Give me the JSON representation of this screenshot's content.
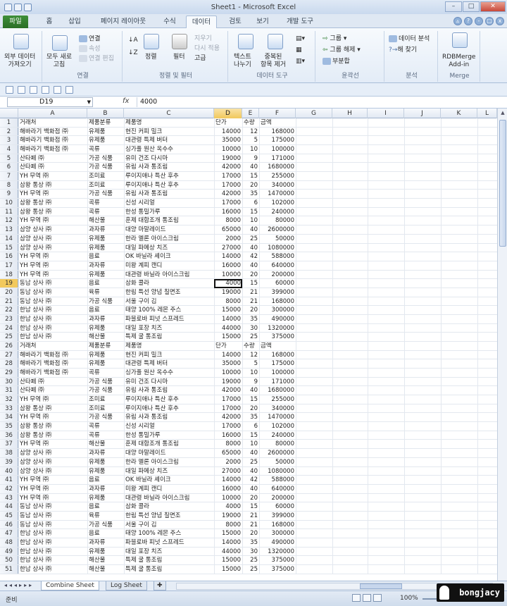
{
  "window": {
    "title": "Sheet1 - Microsoft Excel"
  },
  "tabs": [
    "파일",
    "홈",
    "삽입",
    "페이지 레이아웃",
    "수식",
    "데이터",
    "검토",
    "보기",
    "개발 도구"
  ],
  "active_tab": "데이터",
  "ribbon": {
    "groups": {
      "external": {
        "button": "외부 데이터\n가져오기",
        "label": ""
      },
      "connections": {
        "refresh": "모두 새로\n고침",
        "conn": "연결",
        "props": "속성",
        "edit_links": "연결 편집",
        "label": "연결"
      },
      "sort": {
        "sort": "정렬",
        "filter": "필터",
        "clear": "지우기",
        "reapply": "다시 적용",
        "advanced": "고급",
        "label": "정렬 및 필터"
      },
      "tools": {
        "text": "텍스트\n나누기",
        "dup": "중복된\n항목 제거",
        "label": "데이터 도구"
      },
      "outline": {
        "group": "그룹",
        "ungroup": "그룹 해제",
        "subtotal": "부분합",
        "label": "윤곽선"
      },
      "analysis": {
        "analyze": "데이터 분석",
        "solver": "해 찾기",
        "label": "분석"
      },
      "merge": {
        "btn": "RDBMerge\nAdd-in",
        "label": "Merge"
      }
    }
  },
  "formula_bar": {
    "name_box": "D19",
    "fx": "fx",
    "value": "4000"
  },
  "columns": [
    "A",
    "B",
    "C",
    "D",
    "E",
    "F",
    "G",
    "H",
    "I",
    "J",
    "K",
    "L"
  ],
  "selected_column": "D",
  "selected_row": 19,
  "rows": [
    [
      "거래처",
      "제품분류",
      "제품명",
      "단가",
      "수량",
      "금액"
    ],
    [
      "해바라기 백화점 ㈜",
      "유제품",
      "현진 커피 밀크",
      "14000",
      "12",
      "168000"
    ],
    [
      "해바라기 백화점 ㈜",
      "유제품",
      "대관령 특제 버터",
      "35000",
      "5",
      "175000"
    ],
    [
      "해바라기 백화점 ㈜",
      "곡류",
      "싱가풀 원산 옥수수",
      "10000",
      "10",
      "100000"
    ],
    [
      "산타페 ㈜",
      "가공 식품",
      "유미 건조 다시마",
      "19000",
      "9",
      "171000"
    ],
    [
      "산타페 ㈜",
      "가공 식품",
      "유림 사과 통조림",
      "42000",
      "40",
      "1680000"
    ],
    [
      "YH 무역 ㈜",
      "조미료",
      "루이지애나 특산 후추",
      "17000",
      "15",
      "255000"
    ],
    [
      "삼왕 통상 ㈜",
      "조미료",
      "루이지애나 특산 후추",
      "17000",
      "20",
      "340000"
    ],
    [
      "YH 무역 ㈜",
      "가공 식품",
      "유림 사과 통조림",
      "42000",
      "35",
      "1470000"
    ],
    [
      "삼왕 통상 ㈜",
      "곡류",
      "신성 시리얼",
      "17000",
      "6",
      "102000"
    ],
    [
      "삼왕 통상 ㈜",
      "곡류",
      "한성 통밀가루",
      "16000",
      "15",
      "240000"
    ],
    [
      "YH 무역 ㈜",
      "해산물",
      "훈제 대합조개 통조림",
      "8000",
      "10",
      "80000"
    ],
    [
      "삼양 상사 ㈜",
      "과자류",
      "대양 마말레이드",
      "65000",
      "40",
      "2600000"
    ],
    [
      "삼양 상사 ㈜",
      "유제품",
      "한라 멜론 아이스크림",
      "2000",
      "25",
      "50000"
    ],
    [
      "삼양 상사 ㈜",
      "유제품",
      "대일 파메상 치즈",
      "27000",
      "40",
      "1080000"
    ],
    [
      "YH 무역 ㈜",
      "음료",
      "OK 바닐라 셰이크",
      "14000",
      "42",
      "588000"
    ],
    [
      "YH 무역 ㈜",
      "과자류",
      "미왕 계피 캔디",
      "16000",
      "40",
      "640000"
    ],
    [
      "YH 무역 ㈜",
      "유제품",
      "대관령 바닐라 아이스크림",
      "10000",
      "20",
      "200000"
    ],
    [
      "동남 상사 ㈜",
      "음료",
      "삼화 콜라",
      "4000",
      "15",
      "60000"
    ],
    [
      "동남 상사 ㈜",
      "육류",
      "한림 특선 양념 칠면조",
      "19000",
      "21",
      "399000"
    ],
    [
      "동남 상사 ㈜",
      "가공 식품",
      "서울 구이 김",
      "8000",
      "21",
      "168000"
    ],
    [
      "한남 상사 ㈜",
      "음료",
      "태양 100% 레몬 주스",
      "15000",
      "20",
      "300000"
    ],
    [
      "한남 상사 ㈜",
      "과자류",
      "파블로바 피넛 스프레드",
      "14000",
      "35",
      "490000"
    ],
    [
      "한남 상사 ㈜",
      "유제품",
      "대일 포장 치즈",
      "44000",
      "30",
      "1320000"
    ],
    [
      "한남 상사 ㈜",
      "해산물",
      "특제 굴 통조림",
      "15000",
      "25",
      "375000"
    ],
    [
      "거래처",
      "제품분류",
      "제품명",
      "단가",
      "수량",
      "금액"
    ],
    [
      "해바라기 백화점 ㈜",
      "유제품",
      "현진 커피 밀크",
      "14000",
      "12",
      "168000"
    ],
    [
      "해바라기 백화점 ㈜",
      "유제품",
      "대관령 특제 버터",
      "35000",
      "5",
      "175000"
    ],
    [
      "해바라기 백화점 ㈜",
      "곡류",
      "싱가풀 원산 옥수수",
      "10000",
      "10",
      "100000"
    ],
    [
      "산타페 ㈜",
      "가공 식품",
      "유미 건조 다시마",
      "19000",
      "9",
      "171000"
    ],
    [
      "산타페 ㈜",
      "가공 식품",
      "유림 사과 통조림",
      "42000",
      "40",
      "1680000"
    ],
    [
      "YH 무역 ㈜",
      "조미료",
      "루이지애나 특산 후추",
      "17000",
      "15",
      "255000"
    ],
    [
      "삼왕 통상 ㈜",
      "조미료",
      "루이지애나 특산 후추",
      "17000",
      "20",
      "340000"
    ],
    [
      "YH 무역 ㈜",
      "가공 식품",
      "유림 사과 통조림",
      "42000",
      "35",
      "1470000"
    ],
    [
      "삼왕 통상 ㈜",
      "곡류",
      "신성 시리얼",
      "17000",
      "6",
      "102000"
    ],
    [
      "삼왕 통상 ㈜",
      "곡류",
      "한성 통밀가루",
      "16000",
      "15",
      "240000"
    ],
    [
      "YH 무역 ㈜",
      "해산물",
      "훈제 대합조개 통조림",
      "8000",
      "10",
      "80000"
    ],
    [
      "삼양 상사 ㈜",
      "과자류",
      "대양 마말레이드",
      "65000",
      "40",
      "2600000"
    ],
    [
      "삼양 상사 ㈜",
      "유제품",
      "한라 멜론 아이스크림",
      "2000",
      "25",
      "50000"
    ],
    [
      "삼양 상사 ㈜",
      "유제품",
      "대일 파메상 치즈",
      "27000",
      "40",
      "1080000"
    ],
    [
      "YH 무역 ㈜",
      "음료",
      "OK 바닐라 셰이크",
      "14000",
      "42",
      "588000"
    ],
    [
      "YH 무역 ㈜",
      "과자류",
      "미왕 계피 캔디",
      "16000",
      "40",
      "640000"
    ],
    [
      "YH 무역 ㈜",
      "유제품",
      "대관령 바닐라 아이스크림",
      "10000",
      "20",
      "200000"
    ],
    [
      "동남 상사 ㈜",
      "음료",
      "삼화 콜라",
      "4000",
      "15",
      "60000"
    ],
    [
      "동남 상사 ㈜",
      "육류",
      "한림 특선 양념 칠면조",
      "19000",
      "21",
      "399000"
    ],
    [
      "동남 상사 ㈜",
      "가공 식품",
      "서울 구이 김",
      "8000",
      "21",
      "168000"
    ],
    [
      "한남 상사 ㈜",
      "음료",
      "태양 100% 레몬 주스",
      "15000",
      "20",
      "300000"
    ],
    [
      "한남 상사 ㈜",
      "과자류",
      "파블로바 피넛 스프레드",
      "14000",
      "35",
      "490000"
    ],
    [
      "한남 상사 ㈜",
      "유제품",
      "대일 포장 치즈",
      "44000",
      "30",
      "1320000"
    ],
    [
      "한남 상사 ㈜",
      "해산물",
      "특제 굴 통조림",
      "15000",
      "25",
      "375000"
    ],
    [
      "한남 상사 ㈜",
      "해산물",
      "특제 굴 통조림",
      "15000",
      "25",
      "375000"
    ]
  ],
  "sheet_tabs": [
    "Combine Sheet",
    "Log Sheet"
  ],
  "active_sheet": "Combine Sheet",
  "status": {
    "ready": "준비",
    "zoom": "100%"
  },
  "watermark": "bongjacy"
}
